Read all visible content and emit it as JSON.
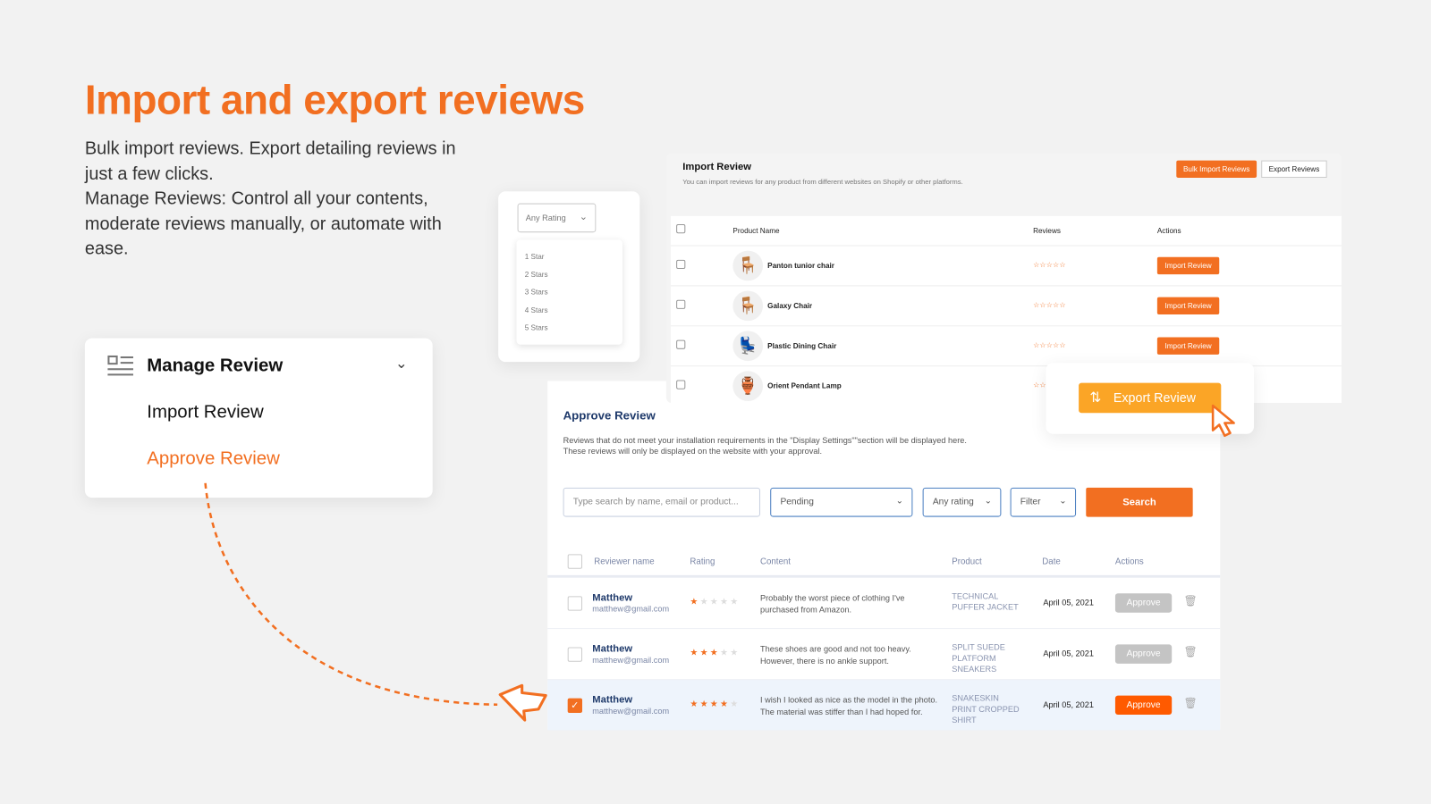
{
  "headline": "Import and export reviews",
  "description": [
    "Bulk import reviews. Export detailing reviews in just a few clicks.",
    "Manage Reviews: Control all your contents, moderate reviews manually, or automate with ease."
  ],
  "menu": {
    "title": "Manage Review",
    "items": [
      "Import Review",
      "Approve Review"
    ],
    "active": "Approve Review"
  },
  "rating_dropdown": {
    "selected": "Any Rating",
    "options": [
      "1 Star",
      "2 Stars",
      "3 Stars",
      "4 Stars",
      "5 Stars"
    ]
  },
  "import_panel": {
    "title": "Import Review",
    "subtitle": "You can import reviews for any product from different websites on Shopify or other platforms.",
    "bulk_button": "Bulk Import Reviews",
    "export_button": "Export Reviews",
    "columns": [
      "Product Name",
      "Reviews",
      "Actions"
    ],
    "rows": [
      {
        "name": "Panton tunior chair",
        "icon": "🪑"
      },
      {
        "name": "Galaxy Chair",
        "icon": "🪑"
      },
      {
        "name": "Plastic Dining Chair",
        "icon": "💺"
      },
      {
        "name": "Orient Pendant Lamp",
        "icon": "🏺"
      }
    ],
    "row_action": "Import Review",
    "stars": "☆☆☆☆☆"
  },
  "export_popup": {
    "label": "Export Review"
  },
  "approve_panel": {
    "title": "Approve Review",
    "note": [
      "Reviews that do not meet your installation requirements in the \"Display Settings\"\"section will be displayed here.",
      "These reviews will only be displayed on the website with your approval."
    ],
    "search_placeholder": "Type search by name, email or product...",
    "status": "Pending",
    "rating": "Any rating",
    "filter": "Filter",
    "search_button": "Search",
    "columns": [
      "Reviewer name",
      "Rating",
      "Content",
      "Product",
      "Date",
      "Actions"
    ],
    "rows": [
      {
        "name": "Matthew",
        "email": "matthew@gmail.com",
        "rating": 1,
        "content": "Probably the worst piece of clothing I've purchased from Amazon.",
        "product": "TECHNICAL PUFFER JACKET",
        "date": "April 05, 2021",
        "action": "Approve",
        "checked": false
      },
      {
        "name": "Matthew",
        "email": "matthew@gmail.com",
        "rating": 3,
        "content": "These shoes are good and not too heavy. However, there is no ankle support.",
        "product": "SPLIT SUEDE PLATFORM SNEAKERS",
        "date": "April 05, 2021",
        "action": "Approve",
        "checked": false
      },
      {
        "name": "Matthew",
        "email": "matthew@gmail.com",
        "rating": 4,
        "content": "I wish I looked as nice as the model in the photo. The material was stiffer than I had hoped for.",
        "product": "SNAKESKIN PRINT CROPPED SHIRT",
        "date": "April 05, 2021",
        "action": "Approve",
        "checked": true
      }
    ]
  },
  "colors": {
    "accent": "#f26f21",
    "export": "#fba526",
    "approve_active": "#ff5a00",
    "approve_disabled": "#c4c4c4",
    "selected_row": "#eef4fc"
  }
}
